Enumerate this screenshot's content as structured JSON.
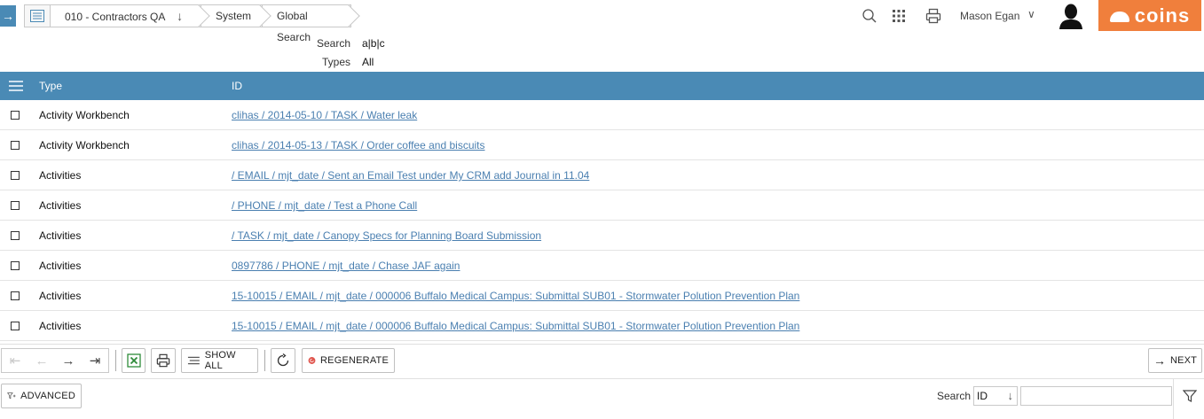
{
  "topbar": {
    "breadcrumbs": [
      {
        "label": "010 - Contractors QA",
        "has_arrow": true
      },
      {
        "label": "System"
      },
      {
        "label": "Global Search"
      }
    ],
    "user_name": "Mason Egan",
    "logo_text": "coins"
  },
  "search_info": {
    "search_label": "Search",
    "search_value": "a|b|c",
    "types_label": "Types",
    "types_value": "All"
  },
  "table": {
    "columns": [
      "Type",
      "ID"
    ],
    "rows": [
      {
        "type": "Activity Workbench",
        "id": "clihas / 2014-05-10 / TASK / Water leak"
      },
      {
        "type": "Activity Workbench",
        "id": "clihas / 2014-05-13 / TASK / Order coffee and biscuits"
      },
      {
        "type": "Activities",
        "id": "/ EMAIL / mjt_date / Sent an Email Test under My CRM add Journal in 11.04"
      },
      {
        "type": "Activities",
        "id": "/ PHONE / mjt_date / Test a Phone Call"
      },
      {
        "type": "Activities",
        "id": "/ TASK / mjt_date / Canopy Specs for Planning Board Submission"
      },
      {
        "type": "Activities",
        "id": "0897786 / PHONE / mjt_date / Chase JAF again"
      },
      {
        "type": "Activities",
        "id": "15-10015 / EMAIL / mjt_date / 000006 Buffalo Medical Campus: Submittal SUB01 - Stormwater Polution Prevention Plan"
      },
      {
        "type": "Activities",
        "id": "15-10015 / EMAIL / mjt_date / 000006 Buffalo Medical Campus: Submittal SUB01 - Stormwater Polution Prevention Plan"
      }
    ]
  },
  "toolbar": {
    "show_all": "SHOW ALL",
    "regenerate": "REGENERATE",
    "next": "NEXT"
  },
  "footer": {
    "advanced": "ADVANCED",
    "search_label": "Search",
    "search_field": "ID",
    "search_value": ""
  },
  "colors": {
    "accent": "#4a8ab5",
    "link": "#4a7fb0",
    "brand": "#f07f3c",
    "regenerate_icon": "#e0574f",
    "excel_icon": "#2e8b3a"
  }
}
